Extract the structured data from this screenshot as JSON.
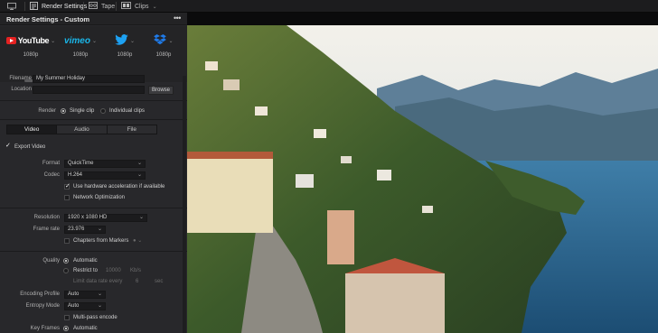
{
  "toolbar": {
    "items": [
      {
        "label": "Render Settings",
        "icon": "render-settings-icon"
      },
      {
        "label": "Tape",
        "icon": "tape-icon"
      },
      {
        "label": "Clips",
        "icon": "clips-icon"
      }
    ]
  },
  "panel": {
    "title": "Render Settings - Custom",
    "menu": "•••",
    "presets": [
      {
        "name": "YouTube",
        "res": "1080p",
        "icon": "youtube-logo"
      },
      {
        "name": "vimeo",
        "res": "1080p",
        "icon": "vimeo-logo"
      },
      {
        "name": "Twitter",
        "res": "1080p",
        "icon": "twitter-bird-icon"
      },
      {
        "name": "Dropbox",
        "res": "1080p",
        "icon": "dropbox-icon"
      }
    ],
    "filename_label": "Filename",
    "filename_value": "My Summer Holiday",
    "location_label": "Location",
    "location_value": "",
    "browse_label": "Browse",
    "render_label": "Render",
    "render_single": "Single clip",
    "render_individual": "Individual clips",
    "tabs": [
      "Video",
      "Audio",
      "File"
    ],
    "export_video": "Export Video",
    "format_label": "Format",
    "format_value": "QuickTime",
    "codec_label": "Codec",
    "codec_value": "H.264",
    "hw_accel": "Use hardware acceleration if available",
    "net_opt": "Network Optimization",
    "resolution_label": "Resolution",
    "resolution_value": "1920 x 1080 HD",
    "framerate_label": "Frame rate",
    "framerate_value": "23.976",
    "chapters": "Chapters from Markers",
    "quality_label": "Quality",
    "quality_auto": "Automatic",
    "restrict_to": "Restrict to",
    "restrict_value": "10000",
    "restrict_unit": "Kb/s",
    "limit_rate": "Limit data rate every",
    "limit_value": "6",
    "limit_unit": "sec",
    "encoding_label": "Encoding Profile",
    "encoding_value": "Auto",
    "entropy_label": "Entropy Mode",
    "entropy_value": "Auto",
    "multipass": "Multi-pass encode",
    "keyframes_label": "Key Frames",
    "keyframes_value": "Automatic"
  },
  "colors": {
    "accent_blue": "#1ab7ea",
    "youtube_red": "#e52222",
    "twitter_blue": "#1da1f2",
    "dropbox_blue": "#1f7ae8"
  }
}
